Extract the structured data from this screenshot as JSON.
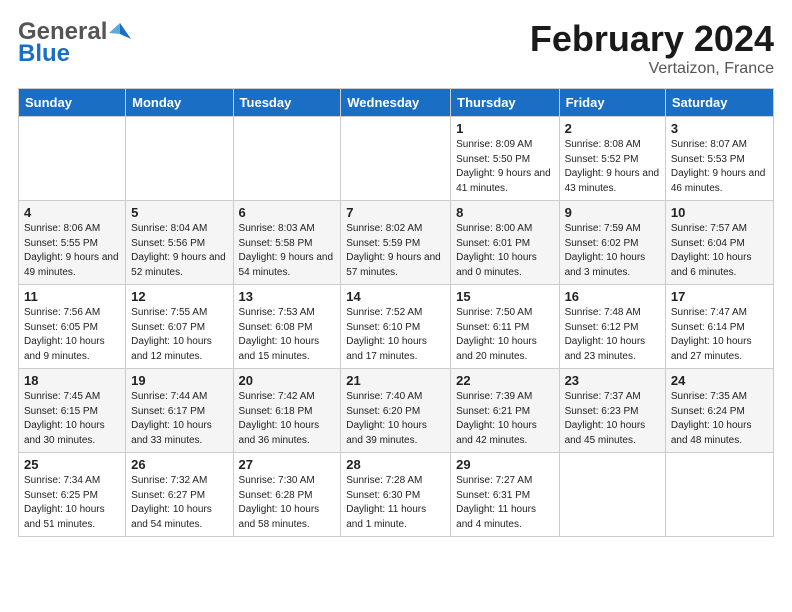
{
  "header": {
    "logo_general": "General",
    "logo_blue": "Blue",
    "month_title": "February 2024",
    "location": "Vertaizon, France"
  },
  "days_of_week": [
    "Sunday",
    "Monday",
    "Tuesday",
    "Wednesday",
    "Thursday",
    "Friday",
    "Saturday"
  ],
  "weeks": [
    [
      {
        "day": "",
        "info": ""
      },
      {
        "day": "",
        "info": ""
      },
      {
        "day": "",
        "info": ""
      },
      {
        "day": "",
        "info": ""
      },
      {
        "day": "1",
        "info": "Sunrise: 8:09 AM\nSunset: 5:50 PM\nDaylight: 9 hours and 41 minutes."
      },
      {
        "day": "2",
        "info": "Sunrise: 8:08 AM\nSunset: 5:52 PM\nDaylight: 9 hours and 43 minutes."
      },
      {
        "day": "3",
        "info": "Sunrise: 8:07 AM\nSunset: 5:53 PM\nDaylight: 9 hours and 46 minutes."
      }
    ],
    [
      {
        "day": "4",
        "info": "Sunrise: 8:06 AM\nSunset: 5:55 PM\nDaylight: 9 hours and 49 minutes."
      },
      {
        "day": "5",
        "info": "Sunrise: 8:04 AM\nSunset: 5:56 PM\nDaylight: 9 hours and 52 minutes."
      },
      {
        "day": "6",
        "info": "Sunrise: 8:03 AM\nSunset: 5:58 PM\nDaylight: 9 hours and 54 minutes."
      },
      {
        "day": "7",
        "info": "Sunrise: 8:02 AM\nSunset: 5:59 PM\nDaylight: 9 hours and 57 minutes."
      },
      {
        "day": "8",
        "info": "Sunrise: 8:00 AM\nSunset: 6:01 PM\nDaylight: 10 hours and 0 minutes."
      },
      {
        "day": "9",
        "info": "Sunrise: 7:59 AM\nSunset: 6:02 PM\nDaylight: 10 hours and 3 minutes."
      },
      {
        "day": "10",
        "info": "Sunrise: 7:57 AM\nSunset: 6:04 PM\nDaylight: 10 hours and 6 minutes."
      }
    ],
    [
      {
        "day": "11",
        "info": "Sunrise: 7:56 AM\nSunset: 6:05 PM\nDaylight: 10 hours and 9 minutes."
      },
      {
        "day": "12",
        "info": "Sunrise: 7:55 AM\nSunset: 6:07 PM\nDaylight: 10 hours and 12 minutes."
      },
      {
        "day": "13",
        "info": "Sunrise: 7:53 AM\nSunset: 6:08 PM\nDaylight: 10 hours and 15 minutes."
      },
      {
        "day": "14",
        "info": "Sunrise: 7:52 AM\nSunset: 6:10 PM\nDaylight: 10 hours and 17 minutes."
      },
      {
        "day": "15",
        "info": "Sunrise: 7:50 AM\nSunset: 6:11 PM\nDaylight: 10 hours and 20 minutes."
      },
      {
        "day": "16",
        "info": "Sunrise: 7:48 AM\nSunset: 6:12 PM\nDaylight: 10 hours and 23 minutes."
      },
      {
        "day": "17",
        "info": "Sunrise: 7:47 AM\nSunset: 6:14 PM\nDaylight: 10 hours and 27 minutes."
      }
    ],
    [
      {
        "day": "18",
        "info": "Sunrise: 7:45 AM\nSunset: 6:15 PM\nDaylight: 10 hours and 30 minutes."
      },
      {
        "day": "19",
        "info": "Sunrise: 7:44 AM\nSunset: 6:17 PM\nDaylight: 10 hours and 33 minutes."
      },
      {
        "day": "20",
        "info": "Sunrise: 7:42 AM\nSunset: 6:18 PM\nDaylight: 10 hours and 36 minutes."
      },
      {
        "day": "21",
        "info": "Sunrise: 7:40 AM\nSunset: 6:20 PM\nDaylight: 10 hours and 39 minutes."
      },
      {
        "day": "22",
        "info": "Sunrise: 7:39 AM\nSunset: 6:21 PM\nDaylight: 10 hours and 42 minutes."
      },
      {
        "day": "23",
        "info": "Sunrise: 7:37 AM\nSunset: 6:23 PM\nDaylight: 10 hours and 45 minutes."
      },
      {
        "day": "24",
        "info": "Sunrise: 7:35 AM\nSunset: 6:24 PM\nDaylight: 10 hours and 48 minutes."
      }
    ],
    [
      {
        "day": "25",
        "info": "Sunrise: 7:34 AM\nSunset: 6:25 PM\nDaylight: 10 hours and 51 minutes."
      },
      {
        "day": "26",
        "info": "Sunrise: 7:32 AM\nSunset: 6:27 PM\nDaylight: 10 hours and 54 minutes."
      },
      {
        "day": "27",
        "info": "Sunrise: 7:30 AM\nSunset: 6:28 PM\nDaylight: 10 hours and 58 minutes."
      },
      {
        "day": "28",
        "info": "Sunrise: 7:28 AM\nSunset: 6:30 PM\nDaylight: 11 hours and 1 minute."
      },
      {
        "day": "29",
        "info": "Sunrise: 7:27 AM\nSunset: 6:31 PM\nDaylight: 11 hours and 4 minutes."
      },
      {
        "day": "",
        "info": ""
      },
      {
        "day": "",
        "info": ""
      }
    ]
  ]
}
